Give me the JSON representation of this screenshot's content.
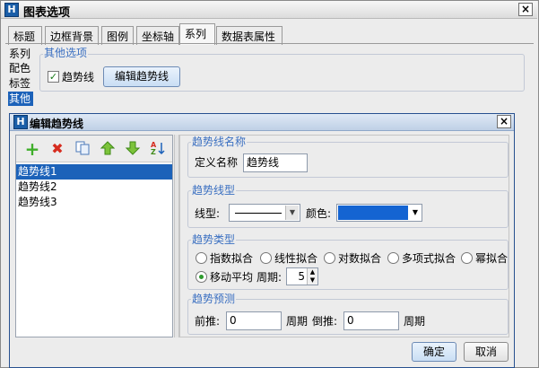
{
  "outer_dialog": {
    "title": "图表选项",
    "close": "×"
  },
  "tabs": [
    "标题",
    "边框背景",
    "图例",
    "坐标轴",
    "系列",
    "数据表属性"
  ],
  "active_tab": "系列",
  "left_nav": [
    "系列",
    "配色",
    "标签",
    "其他"
  ],
  "left_nav_selected": "其他",
  "other_options": {
    "legend": "其他选项",
    "trendline_checkbox_label": "趋势线",
    "trendline_checked": true,
    "edit_button": "编辑趋势线"
  },
  "trend_dialog": {
    "title": "编辑趋势线",
    "close": "×",
    "toolbar_icons": [
      "add-icon",
      "delete-icon",
      "copy-icon",
      "move-up-icon",
      "move-down-icon",
      "sort-icon"
    ],
    "list_items": [
      "趋势线1",
      "趋势线2",
      "趋势线3"
    ],
    "selected_item": "趋势线1",
    "name_group": {
      "legend": "趋势线名称",
      "label": "定义名称",
      "value": "趋势线"
    },
    "style_group": {
      "legend": "趋势线型",
      "line_label": "线型:",
      "color_label": "颜色:",
      "color_value": "#1464d2"
    },
    "type_group": {
      "legend": "趋势类型",
      "options": [
        "指数拟合",
        "线性拟合",
        "对数拟合",
        "多项式拟合",
        "幂拟合",
        "移动平均"
      ],
      "selected": "移动平均",
      "period_label": "周期:",
      "period_value": "5"
    },
    "forecast_group": {
      "legend": "趋势预测",
      "forward_label": "前推:",
      "forward_value": "0",
      "forward_unit": "周期",
      "backward_label": "倒推:",
      "backward_value": "0",
      "backward_unit": "周期"
    },
    "ok_button": "确定",
    "cancel_button": "取消"
  }
}
